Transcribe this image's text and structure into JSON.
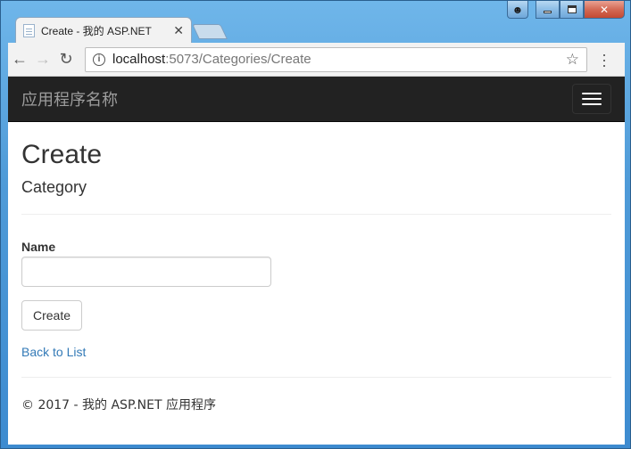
{
  "browser": {
    "tab": {
      "title": "Create - 我的 ASP.NET"
    },
    "address": {
      "host": "localhost",
      "path": ":5073/Categories/Create"
    }
  },
  "site": {
    "brand": "应用程序名称"
  },
  "page": {
    "title": "Create",
    "subtitle": "Category",
    "form": {
      "name_label": "Name",
      "name_value": "",
      "submit_label": "Create"
    },
    "back_link": "Back to List",
    "footer": "© 2017 - 我的 ASP.NET 应用程序"
  }
}
